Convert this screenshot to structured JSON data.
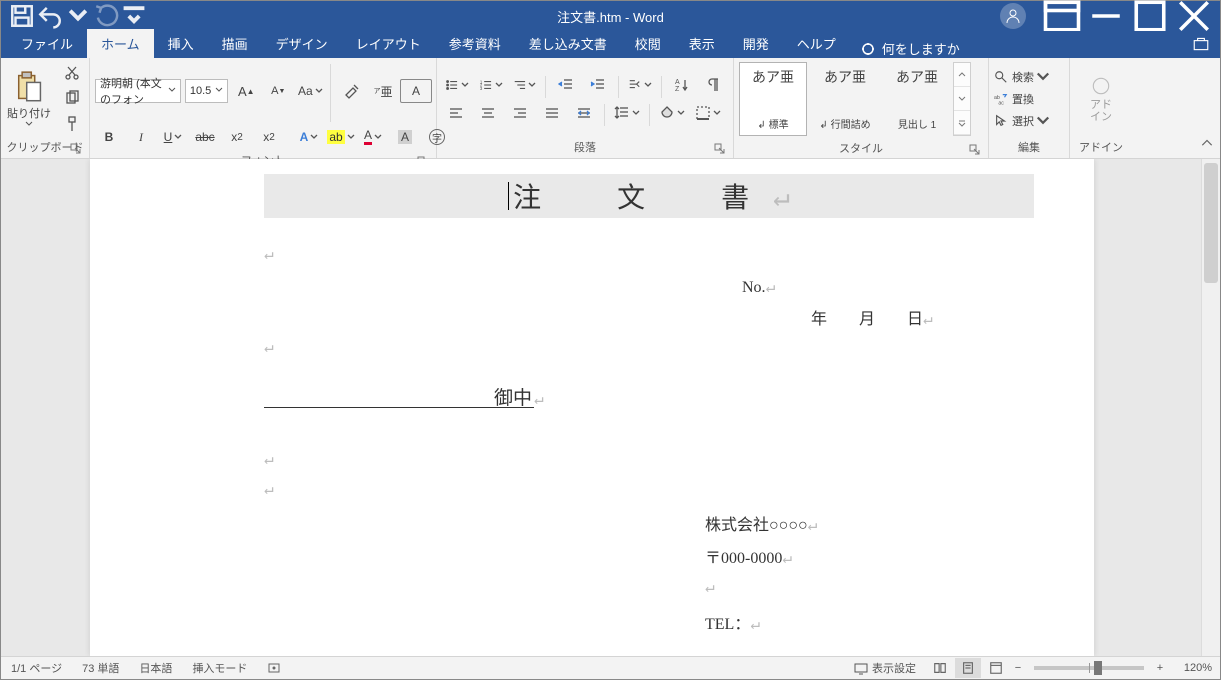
{
  "title": "注文書.htm  -  Word",
  "qat": {
    "save": "save",
    "undo": "undo",
    "redo": "redo",
    "cust": "customize"
  },
  "tabs": {
    "file": "ファイル",
    "home": "ホーム",
    "insert": "挿入",
    "draw": "描画",
    "design": "デザイン",
    "layout": "レイアウト",
    "references": "参考資料",
    "mailings": "差し込み文書",
    "review": "校閲",
    "view": "表示",
    "developer": "開発",
    "help": "ヘルプ"
  },
  "tellme": "何をしますか",
  "ribbon": {
    "clipboard": {
      "label": "クリップボード",
      "paste": "貼り付け"
    },
    "font": {
      "label": "フォント",
      "name": "游明朝 (本文のフォン",
      "size": "10.5"
    },
    "paragraph": {
      "label": "段落"
    },
    "styles": {
      "label": "スタイル",
      "items": [
        {
          "sample": "あア亜",
          "name": "↲ 標準"
        },
        {
          "sample": "あア亜",
          "name": "↲ 行間詰め"
        },
        {
          "sample": "あア亜",
          "name": "見出し 1"
        }
      ]
    },
    "edit": {
      "label": "編集",
      "find": "検索",
      "replace": "置換",
      "select": "選択"
    },
    "addin": {
      "label": "アドイン",
      "btn": "アド\nイン"
    }
  },
  "document": {
    "heading": "注　文　書",
    "no_label": "No.",
    "date": "年　　月　　日",
    "onchu": "御中",
    "company": "株式会社○○○○",
    "postal": "〒000-0000",
    "tel": "TEL："
  },
  "status": {
    "page": "1/1 ページ",
    "words": "73 単語",
    "lang": "日本語",
    "mode": "挿入モード",
    "display": "表示設定",
    "zoom": "120%"
  }
}
